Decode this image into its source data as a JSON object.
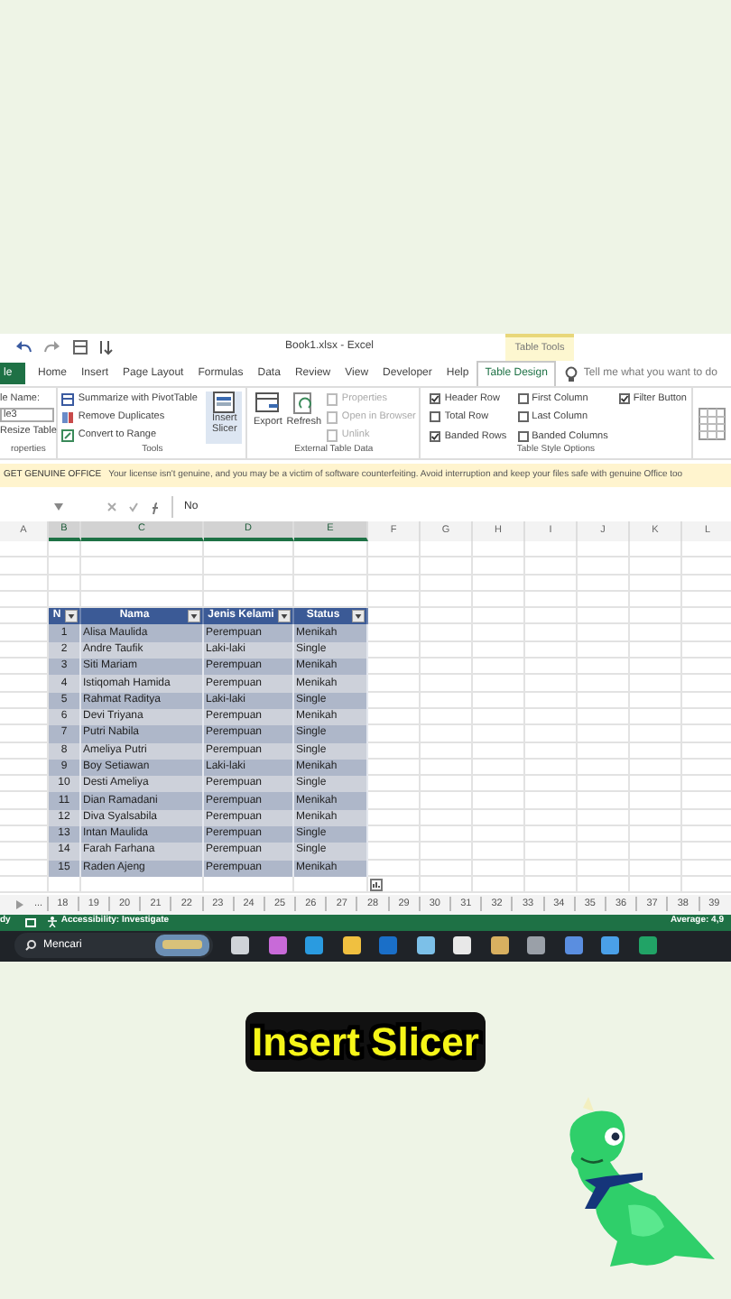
{
  "title_bar": {
    "file_title": "Book1.xlsx - Excel",
    "context_label": "Table Tools"
  },
  "ribbon_tabs": [
    {
      "label": "le",
      "kind": "file",
      "selected": false
    },
    {
      "label": "Home",
      "kind": "tab",
      "selected": false
    },
    {
      "label": "Insert",
      "kind": "tab",
      "selected": false
    },
    {
      "label": "Page Layout",
      "kind": "tab",
      "selected": false
    },
    {
      "label": "Formulas",
      "kind": "tab",
      "selected": false
    },
    {
      "label": "Data",
      "kind": "tab",
      "selected": false
    },
    {
      "label": "Review",
      "kind": "tab",
      "selected": false
    },
    {
      "label": "View",
      "kind": "tab",
      "selected": false
    },
    {
      "label": "Developer",
      "kind": "tab",
      "selected": false
    },
    {
      "label": "Help",
      "kind": "tab",
      "selected": false
    },
    {
      "label": "Table Design",
      "kind": "tab",
      "selected": true
    }
  ],
  "tell_me": "Tell me what you want to do",
  "ribbon_groups": {
    "properties": {
      "label": "roperties",
      "name_label": "le Name:",
      "name_value": "le3",
      "button": "Resize Table"
    },
    "tools": {
      "label": "Tools",
      "buttons": [
        "Summarize with PivotTable",
        "Remove Duplicates",
        "Convert to Range"
      ],
      "large_button": "Insert Slicer"
    },
    "external": {
      "label": "External Table Data",
      "large_buttons": [
        "Export",
        "Refresh"
      ],
      "buttons": [
        {
          "label": "Properties",
          "disabled": true
        },
        {
          "label": "Open in Browser",
          "disabled": true
        },
        {
          "label": "Unlink",
          "disabled": true
        }
      ]
    },
    "style_options": {
      "label": "Table Style Options",
      "options": [
        {
          "label": "Header Row",
          "checked": true
        },
        {
          "label": "Total Row",
          "checked": false
        },
        {
          "label": "Banded Rows",
          "checked": true
        },
        {
          "label": "First Column",
          "checked": false
        },
        {
          "label": "Last Column",
          "checked": false
        },
        {
          "label": "Banded Columns",
          "checked": false
        },
        {
          "label": "Filter Button",
          "checked": true
        }
      ]
    }
  },
  "message_bar": {
    "title": "GET GENUINE OFFICE",
    "text": "Your license isn't genuine, and you may be a victim of software counterfeiting. Avoid interruption and keep your files safe with genuine Office too"
  },
  "formula_bar": {
    "value": "No"
  },
  "columns": [
    {
      "label": "A",
      "selected": false
    },
    {
      "label": "B",
      "selected": true
    },
    {
      "label": "C",
      "selected": true
    },
    {
      "label": "D",
      "selected": true
    },
    {
      "label": "E",
      "selected": true
    },
    {
      "label": "F",
      "selected": false
    },
    {
      "label": "G",
      "selected": false
    },
    {
      "label": "H",
      "selected": false
    },
    {
      "label": "I",
      "selected": false
    },
    {
      "label": "J",
      "selected": false
    },
    {
      "label": "K",
      "selected": false
    },
    {
      "label": "L",
      "selected": false
    }
  ],
  "table": {
    "columns": [
      "N",
      "Nama",
      "Jenis Kelami",
      "Status"
    ],
    "rows": [
      [
        "1",
        "Alisa Maulida",
        "Perempuan",
        "Menikah"
      ],
      [
        "2",
        "Andre Taufik",
        "Laki-laki",
        "Single"
      ],
      [
        "3",
        "Siti Mariam",
        "Perempuan",
        "Menikah"
      ],
      [
        "4",
        "Istiqomah Hamida",
        "Perempuan",
        "Menikah"
      ],
      [
        "5",
        "Rahmat Raditya",
        "Laki-laki",
        "Single"
      ],
      [
        "6",
        "Devi Triyana",
        "Perempuan",
        "Menikah"
      ],
      [
        "7",
        "Putri Nabila",
        "Perempuan",
        "Single"
      ],
      [
        "8",
        "Ameliya Putri",
        "Perempuan",
        "Single"
      ],
      [
        "9",
        "Boy Setiawan",
        "Laki-laki",
        "Menikah"
      ],
      [
        "10",
        "Desti Ameliya",
        "Perempuan",
        "Single"
      ],
      [
        "11",
        "Dian Ramadani",
        "Perempuan",
        "Menikah"
      ],
      [
        "12",
        "Diva Syalsabila",
        "Perempuan",
        "Menikah"
      ],
      [
        "13",
        "Intan Maulida",
        "Perempuan",
        "Single"
      ],
      [
        "14",
        "Farah Farhana",
        "Perempuan",
        "Single"
      ],
      [
        "15",
        "Raden Ajeng",
        "Perempuan",
        "Menikah"
      ]
    ]
  },
  "sheet_tabs": {
    "more": "...",
    "tabs": [
      "18",
      "19",
      "20",
      "21",
      "22",
      "23",
      "24",
      "25",
      "26",
      "27",
      "28",
      "29",
      "30",
      "31",
      "32",
      "33",
      "34",
      "35",
      "36",
      "37",
      "38",
      "39"
    ]
  },
  "status_bar": {
    "ready": "dy",
    "accessibility": "Accessibility: Investigate",
    "average": "Average: 4,9"
  },
  "taskbar": {
    "search": "Mencari"
  },
  "caption": "Insert Slicer"
}
